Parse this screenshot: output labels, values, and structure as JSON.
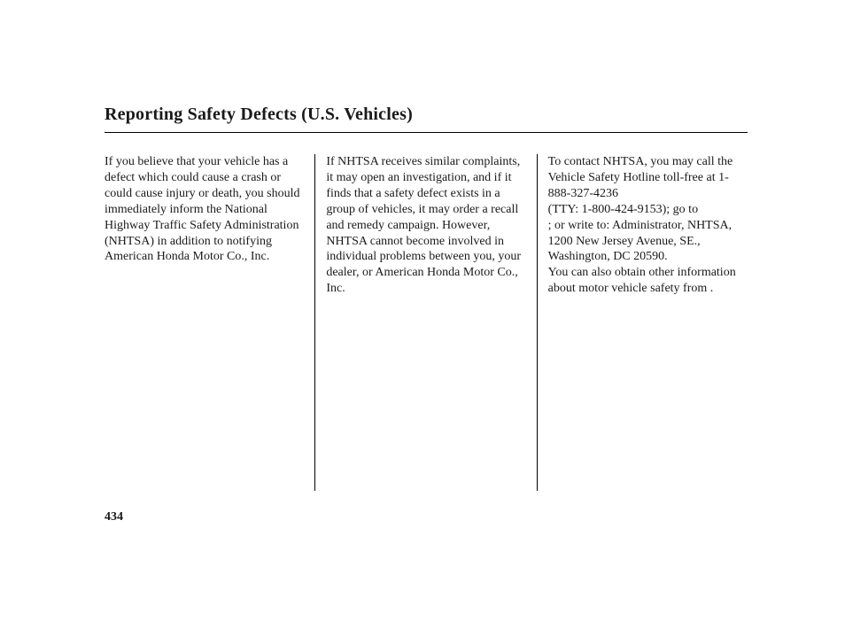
{
  "title": "Reporting Safety Defects (U.S. Vehicles)",
  "columns": {
    "c1": "If you believe that your vehicle has a defect which could cause a crash or could cause injury or death, you should immediately inform the National Highway Traffic Safety Administration (NHTSA) in addition to notifying American Honda Motor Co., Inc.",
    "c2": "If NHTSA receives similar com­plaints, it may open an investigation, and if it finds that a safety defect exists in a group of vehicles, it may order a recall and remedy campaign. However, NHTSA cannot become involved in individual problems between you, your dealer, or American Honda Motor Co., Inc.",
    "c3": "To contact NHTSA, you may call the Vehicle Safety Hotline toll-free at 1-888-327-4236\n(TTY: 1-800-424-9153); go to\n                                   ; or write to: Administrator, NHTSA, 1200 New Jersey Avenue, SE., Washington, DC 20590.\nYou can also obtain other information about motor vehicle safety from                                  ."
  },
  "page_number": "434"
}
